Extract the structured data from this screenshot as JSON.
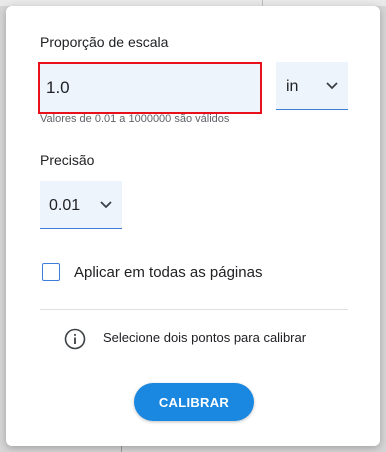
{
  "dialog": {
    "scale_ratio": {
      "label": "Proporção de escala",
      "value": "1.0",
      "hint": "Valores de 0.01 a 1000000 são válidos"
    },
    "unit_select": {
      "value": "in",
      "icon": "chevron-down-icon"
    },
    "precision": {
      "label": "Precisão",
      "value": "0.01",
      "icon": "chevron-down-icon"
    },
    "apply_all_pages": {
      "label": "Aplicar em todas as páginas",
      "checked": false
    },
    "info": {
      "icon": "info-icon",
      "text": "Selecione dois pontos para calibrar"
    },
    "calibrate_button": {
      "label": "CALIBRAR"
    }
  },
  "colors": {
    "accent": "#1a88e0",
    "focus_border": "#e8101b",
    "field_background": "#eef4fb",
    "underline": "#3c7dd6"
  }
}
